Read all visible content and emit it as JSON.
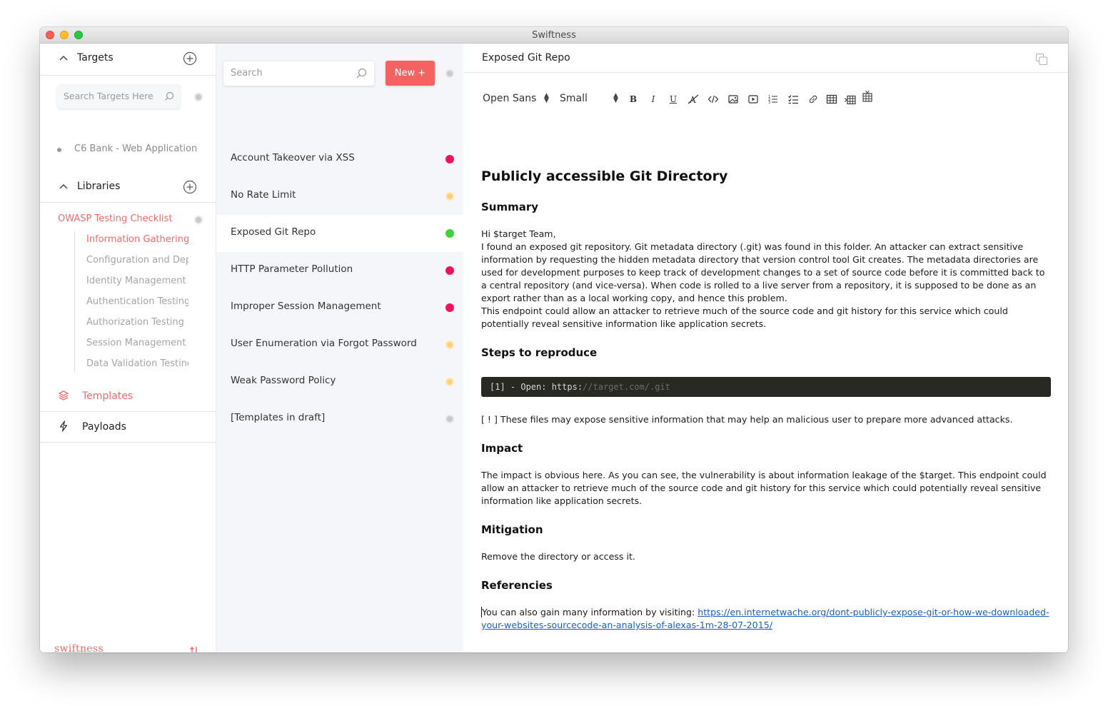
{
  "window": {
    "title": "Swiftness"
  },
  "sidebar": {
    "targets_label": "Targets",
    "search_placeholder": "Search Targets Here",
    "targets": [
      {
        "label": "C6 Bank - Web Application"
      }
    ],
    "libraries_label": "Libraries",
    "library": {
      "title": "OWASP Testing Checklist",
      "items": [
        {
          "label": "Information Gathering",
          "active": true
        },
        {
          "label": "Configuration and Dep",
          "active": false
        },
        {
          "label": "Identity Management T",
          "active": false
        },
        {
          "label": "Authentication Testing",
          "active": false
        },
        {
          "label": "Authorization Testing",
          "active": false
        },
        {
          "label": "Session Management T",
          "active": false
        },
        {
          "label": "Data Validation Testing",
          "active": false
        }
      ]
    },
    "templates_label": "Templates",
    "payloads_label": "Payloads",
    "brand": "swiftness"
  },
  "list": {
    "search_placeholder": "Search",
    "new_button": "New +",
    "items": [
      {
        "label": "Account Takeover via XSS",
        "status": "critical"
      },
      {
        "label": "No Rate Limit",
        "status": "low"
      },
      {
        "label": "Exposed Git Repo",
        "status": "ok",
        "active": true
      },
      {
        "label": "HTTP Parameter Pollution",
        "status": "critical"
      },
      {
        "label": "Improper Session Management",
        "status": "critical"
      },
      {
        "label": "User Enumeration via Forgot Password",
        "status": "low"
      },
      {
        "label": "Weak Password Policy",
        "status": "low"
      },
      {
        "label": "[Templates in draft]",
        "status": "draft"
      }
    ]
  },
  "editor": {
    "title": "Exposed Git Repo",
    "toolbar": {
      "font": "Open Sans",
      "size": "Small"
    },
    "doc": {
      "heading": "Publicly accessible Git Directory",
      "summary_heading": "Summary",
      "summary_lines": [
        "Hi $target Team,",
        "I found an exposed git repository. Git metadata directory (.git) was found in this folder. An attacker can extract sensitive information by requesting the hidden metadata directory that version control tool Git creates. The metadata directories are used for development purposes to keep track of development changes to a set of source code before it is committed back to a central repository (and vice-versa). When code is rolled to a live server from a repository, it is supposed to be done as an export rather than as a local working copy, and hence this problem.",
        "This endpoint could allow an attacker to retrieve much of the source code and git history for this service which could potentially reveal sensitive information like application secrets."
      ],
      "steps_heading": "Steps to reproduce",
      "code_prefix": "[1] - Open: https:",
      "code_comment": "//target.com/.git",
      "steps_note": "[ ! ] These files may expose sensitive information that may help an malicious user to prepare more advanced attacks.",
      "impact_heading": "Impact",
      "impact_text": "The impact is obvious here. As you can see, the vulnerability is about information leakage of the $target. This endpoint could allow an attacker to retrieve much of the source code and git history for this service which could potentially reveal sensitive information like application secrets.",
      "mitigation_heading": "Mitigation",
      "mitigation_text": "Remove the directory or access it.",
      "references_heading": "Referencies",
      "references_prefix": "You can also gain many information by visiting: ",
      "references_link": "https://en.internetwache.org/dont-publicly-expose-git-or-how-we-downloaded-your-websites-sourcecode-an-analysis-of-alexas-1m-28-07-2015/"
    }
  },
  "colors": {
    "accent": "#f46262",
    "status_critical": "#f0125a",
    "status_low": "#fbd27a",
    "status_ok": "#3fd23f",
    "status_draft": "#c9c9c9"
  }
}
